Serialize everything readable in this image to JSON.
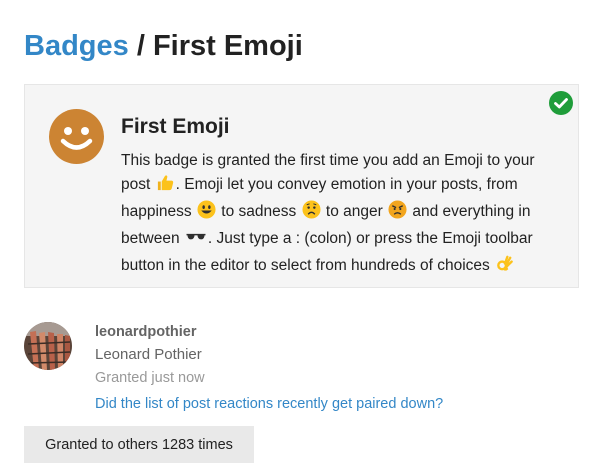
{
  "header": {
    "breadcrumb_link": "Badges",
    "separator": " / ",
    "current": "First Emoji"
  },
  "badge": {
    "name": "First Emoji",
    "icon": "smiley-face-icon",
    "icon_color": "#cc8433",
    "granted": true,
    "check_color": "#1f9d3a",
    "description": {
      "p1": "This badge is granted the first time you add an Emoji to your post",
      "p2": ". Emoji let you convey emotion in your posts, from happiness",
      "p3": " to sadness",
      "p4": " to anger",
      "p5": " and everything in between",
      "p6": ". Just type a : (colon) or press the Emoji toolbar button in the editor to select from hundreds of choices"
    }
  },
  "grant": {
    "username": "leonardpothier",
    "full_name": "Leonard Pothier",
    "granted_time": "Granted just now",
    "post_title": "Did the list of post reactions recently get paired down?"
  },
  "others_button": "Granted to others 1283 times",
  "colors": {
    "link": "#3387c7",
    "muted": "#646464",
    "light": "#999999",
    "card_bg": "#f5f5f5"
  }
}
